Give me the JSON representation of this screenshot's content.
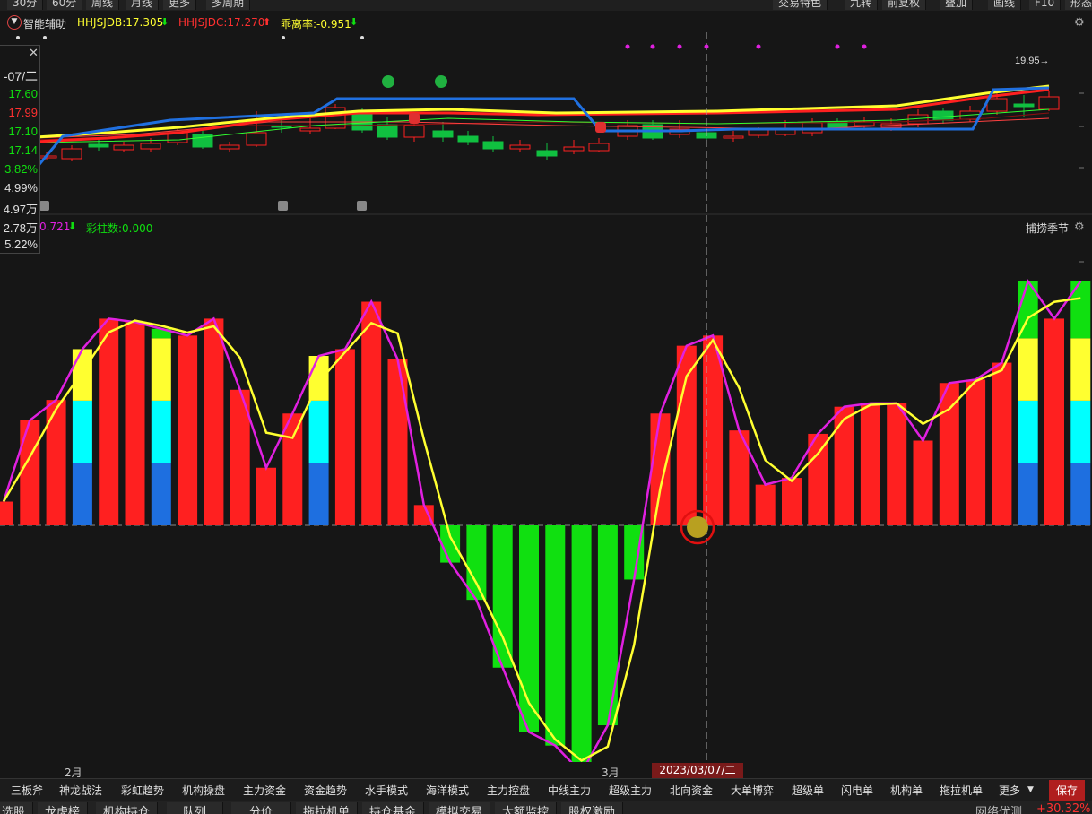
{
  "topbar": {
    "left_buttons": [
      "30分",
      "60分",
      "周线",
      "月线",
      "更多",
      "多周期"
    ],
    "right_buttons": [
      "交易特色",
      "九转",
      "前复权",
      "叠加",
      "画线",
      "F10",
      "形态"
    ]
  },
  "indicator_bar": {
    "name": "智能辅助",
    "hhjsjdb": "HHJSJDB:17.305",
    "hhjsjdc": "HHJSJDC:17.270",
    "guaili": "乖离率:-0.951"
  },
  "left_panel": {
    "date": "-07/二",
    "values": [
      "17.60",
      "17.99",
      "17.10",
      "17.14",
      "3.82%",
      "4.99%",
      "4.97万",
      "2.78万",
      "5.22%"
    ],
    "close_glyph": "✕"
  },
  "upper_chart": {
    "max_label": "19.95"
  },
  "lower_indicator": {
    "value1": "0.721",
    "caizhushu": "彩柱数:0.000",
    "title_right": "捕捞季节"
  },
  "axis": {
    "feb": "2月",
    "mar": "3月",
    "cursor_date": "2023/03/07/二"
  },
  "tabs": [
    "三板斧",
    "神龙战法",
    "彩虹趋势",
    "机构操盘",
    "主力资金",
    "资金趋势",
    "水手模式",
    "海洋模式",
    "主力控盘",
    "中线主力",
    "超级主力",
    "北向资金",
    "大单博弈",
    "超级单",
    "闪电单",
    "机构单",
    "拖拉机单",
    "更多"
  ],
  "save_button": "保存",
  "tabs2": [
    "选股",
    "龙虎榜",
    "机构持仓",
    "队列",
    "分价",
    "拖拉机单",
    "持仓基金",
    "模拟交易",
    "大额监控",
    "股权激励"
  ],
  "net_status": "网络优测",
  "net_value": "+30.32%",
  "colors": {
    "up": "#ff2020",
    "down": "#10e010",
    "yellow": "#ffff30",
    "cyan": "#00ffff",
    "blue": "#1e6fe0",
    "magenta": "#e020e0",
    "accent_red": "#c81e1e"
  },
  "chart_data": {
    "type": "bar",
    "series": [
      {
        "values": [
          0.7,
          3.1,
          3.7,
          5.2,
          6.1,
          6.0,
          5.8,
          5.6,
          6.1,
          4.0,
          1.7,
          3.3,
          5.0,
          5.2,
          6.6,
          4.9,
          0.6,
          -1.1,
          -2.2,
          -4.2,
          -6.1,
          -6.5,
          -7.3,
          -5.9,
          -1.6,
          3.3,
          5.3,
          5.6,
          2.8,
          1.2,
          1.4,
          2.7,
          3.5,
          3.6,
          3.6,
          2.5,
          4.2,
          4.3,
          4.8,
          7.2,
          6.1,
          7.2
        ]
      }
    ],
    "ylim": [
      -7.5,
      9
    ]
  }
}
